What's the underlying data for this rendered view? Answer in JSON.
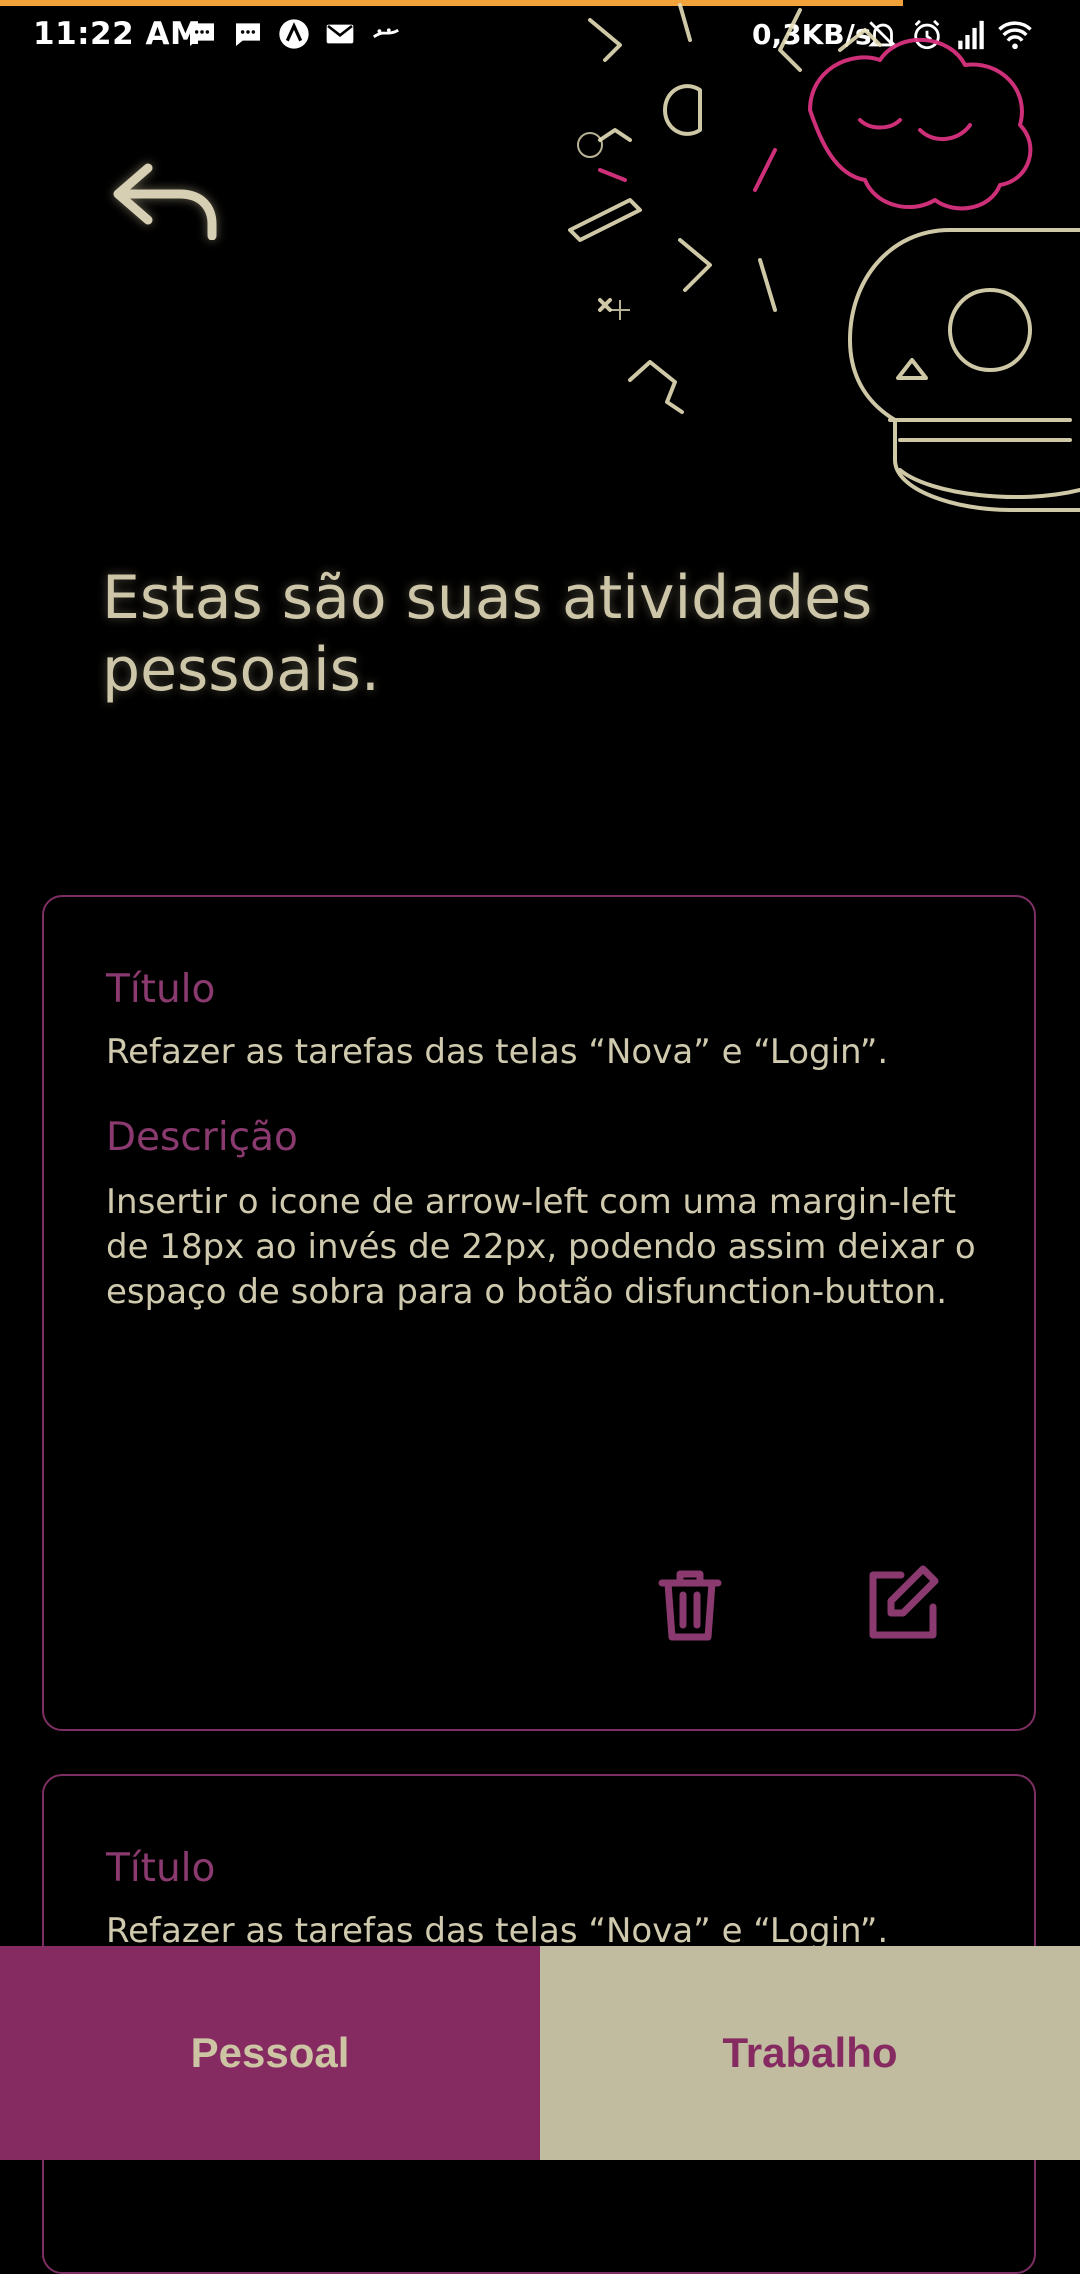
{
  "status_bar": {
    "time": "11:22 AM",
    "network_speed": "0,3KB/s",
    "left_icons": [
      "message-icon",
      "message-icon",
      "arrow-up-circle-icon",
      "mail-icon",
      "ifood-icon"
    ],
    "right_icons": [
      "bell-off-icon",
      "alarm-icon",
      "signal-icon",
      "wifi-icon"
    ]
  },
  "header": {
    "back_icon": "back-arrow-icon",
    "heading": "Estas são suas atividades pessoais."
  },
  "tasks": [
    {
      "title_label": "Título",
      "title": "Refazer as tarefas das telas “Nova” e “Login”.",
      "description_label": "Descrição",
      "description": "Insertir o icone de arrow-left com uma margin-left de 18px ao invés de 22px, podendo assim deixar o espaço de sobra para o botão disfunction-button.",
      "actions": [
        "trash-icon",
        "edit-icon"
      ]
    },
    {
      "title_label": "Título",
      "title": "Refazer as tarefas das telas “Nova” e “Login”."
    }
  ],
  "tabs": {
    "pessoal": "Pessoal",
    "trabalho": "Trabalho"
  },
  "colors": {
    "background": "#000000",
    "accent": "#862b62",
    "neutral": "#c1bc9f",
    "text": "#cdc6a8"
  }
}
